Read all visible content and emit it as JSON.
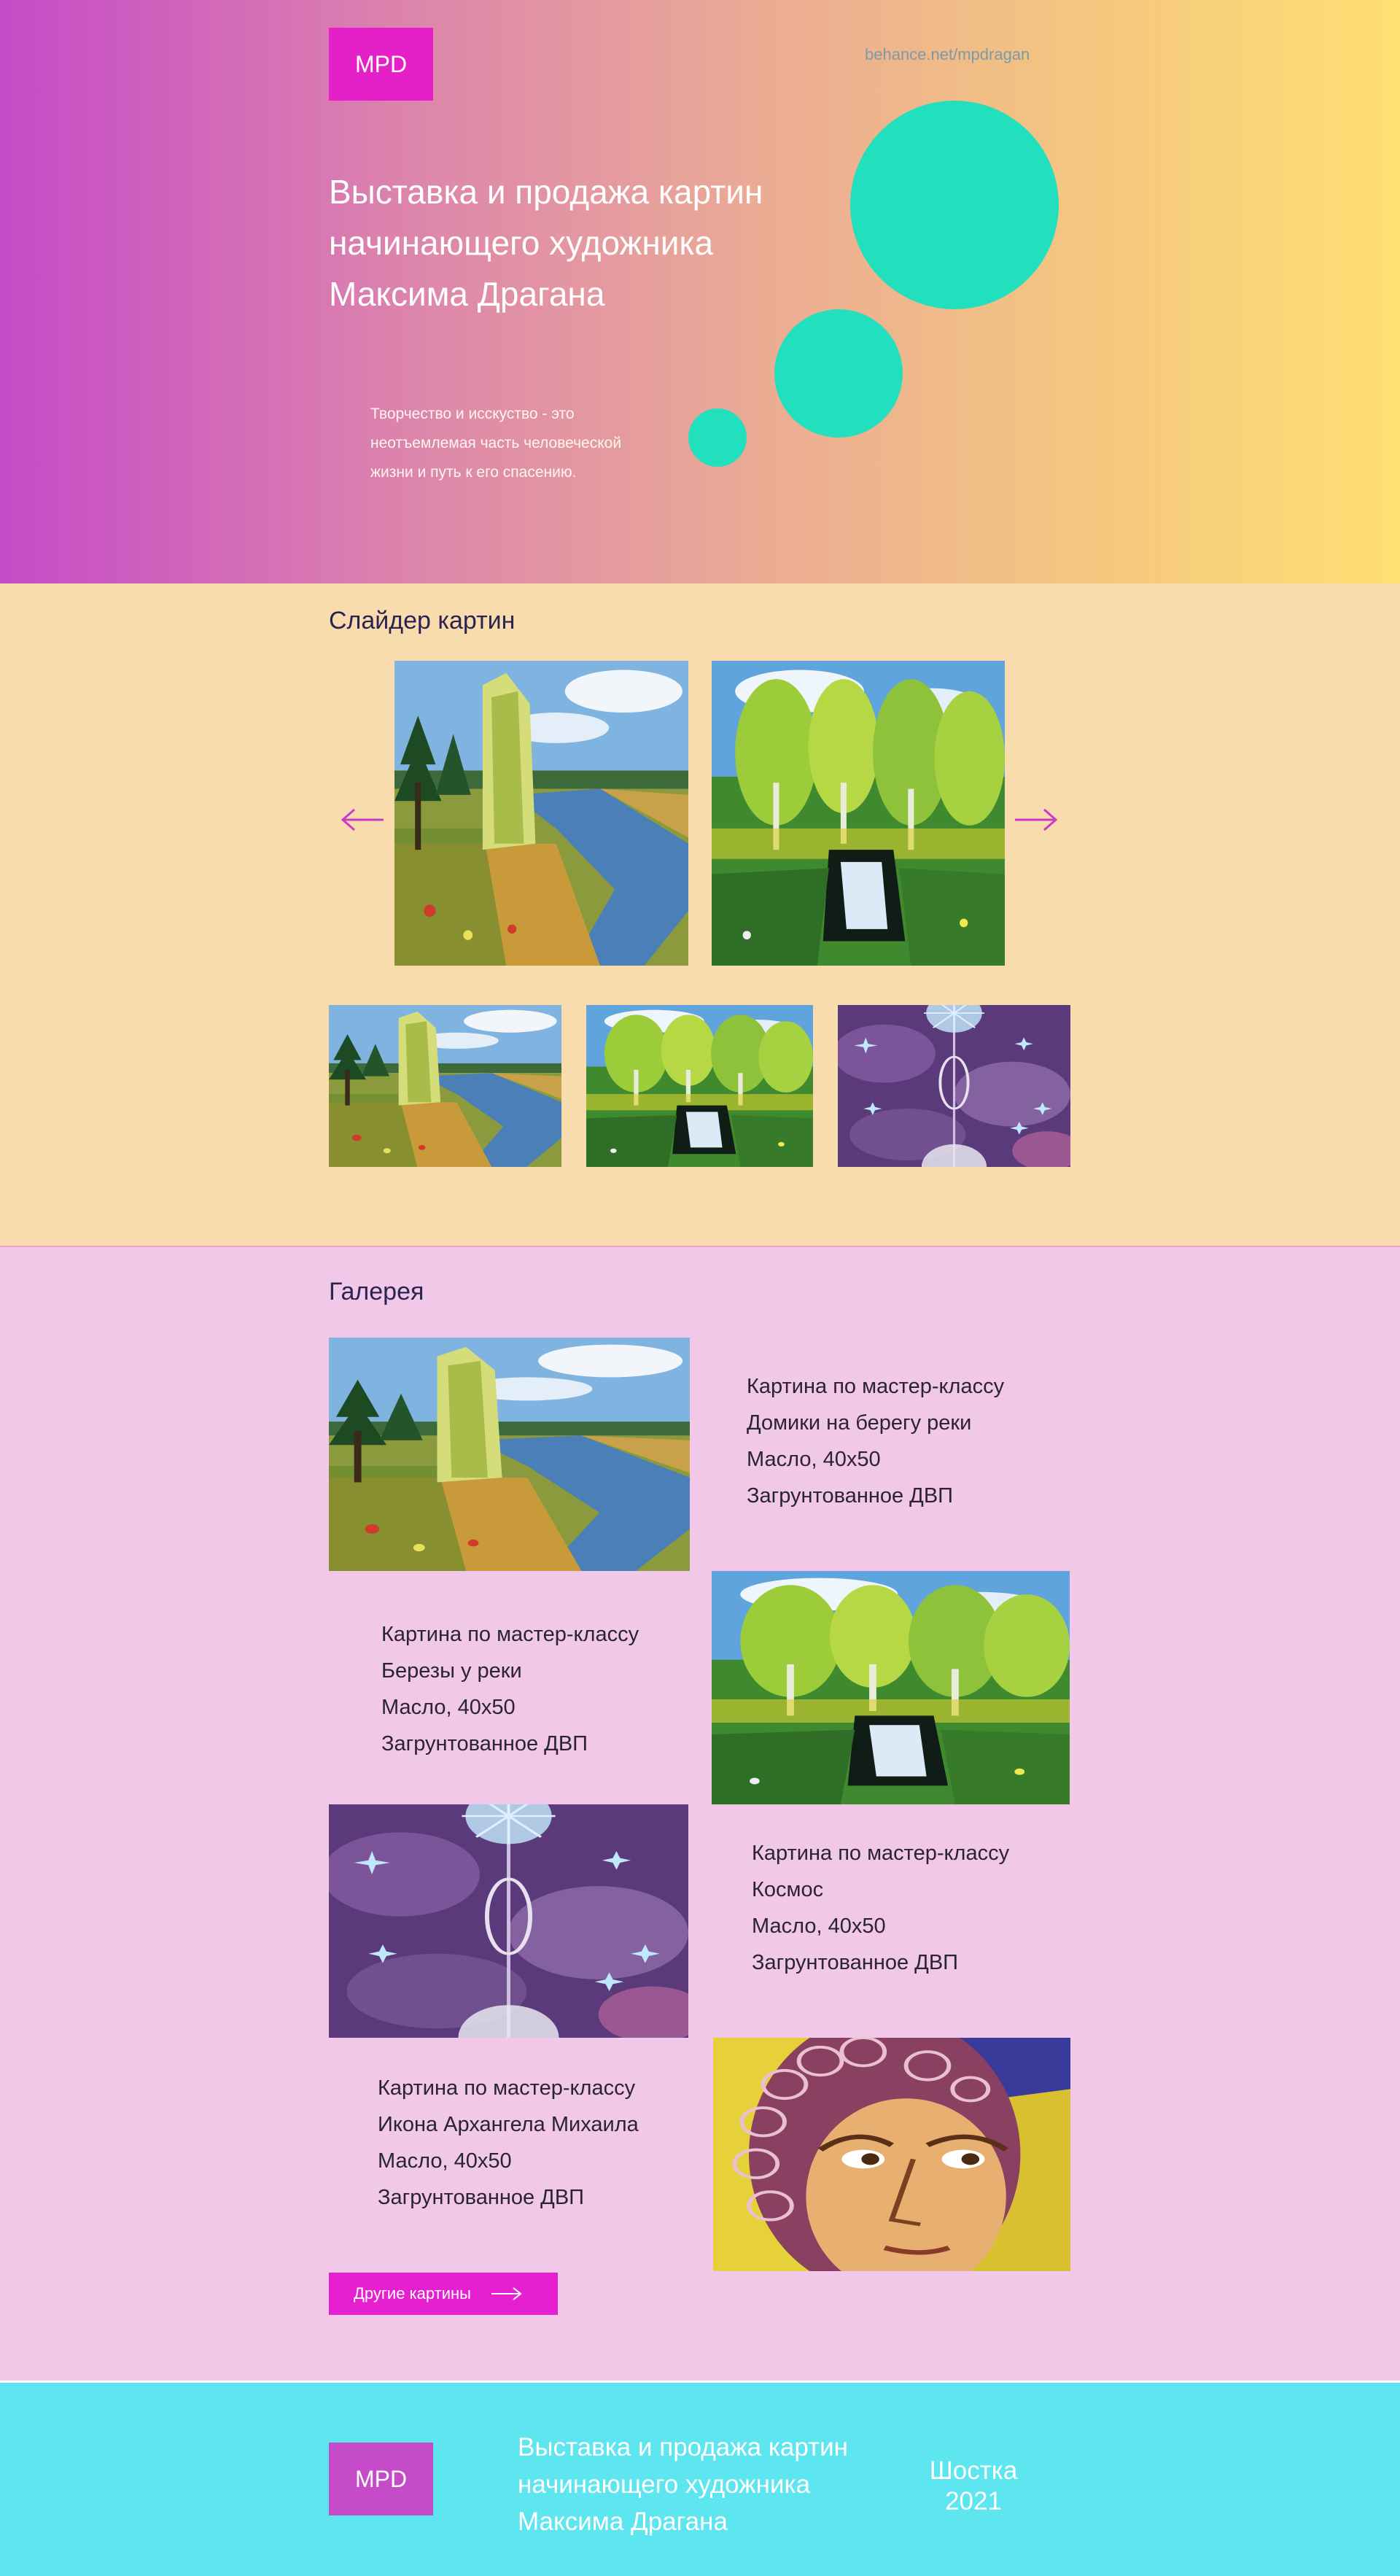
{
  "header": {
    "logo": "MPD",
    "link": "behance.net/mpdragan",
    "title_lines": [
      "Выставка и продажа картин",
      "начинающего художника",
      "Максима Драгана"
    ],
    "subtitle_lines": [
      "Творчество и исскуство - это",
      "неотъемлемая часть человеческой",
      "жизни и путь к его спасению."
    ]
  },
  "slider": {
    "title": "Слайдер картин",
    "paintings": [
      "river-landscape",
      "willows-pond"
    ],
    "thumbnails": [
      "river-landscape",
      "willows-pond",
      "cosmos"
    ]
  },
  "gallery": {
    "title": "Галерея",
    "items": [
      {
        "painting": "river-landscape",
        "lines": [
          "Картина по мастер-классу",
          "Домики на берегу реки",
          "Масло, 40x50",
          "Загрунтованное ДВП"
        ]
      },
      {
        "painting": "willows-pond",
        "lines": [
          "Картина по мастер-классу",
          "Березы у реки",
          "Масло, 40x50",
          "Загрунтованное ДВП"
        ]
      },
      {
        "painting": "cosmos",
        "lines": [
          "Картина по мастер-классу",
          "Космос",
          "Масло, 40x50",
          "Загрунтованное ДВП"
        ]
      },
      {
        "painting": "archangel-icon",
        "lines": [
          "Картина по мастер-классу",
          "Икона Архангела Михаила",
          "Масло, 40x50",
          "Загрунтованное ДВП"
        ]
      }
    ],
    "more_button": "Другие картины"
  },
  "footer": {
    "logo": "MPD",
    "title_lines": [
      "Выставка и продажа картин",
      "начинающего художника",
      "Максима Драгана"
    ],
    "city": "Шостка",
    "year": "2021"
  },
  "colors": {
    "accent_magenta": "#e620c9",
    "accent_teal": "#22e0bd",
    "slider_bg": "#f8dcae",
    "gallery_bg": "#f2c8e9",
    "footer_bg": "#5de5f0"
  }
}
